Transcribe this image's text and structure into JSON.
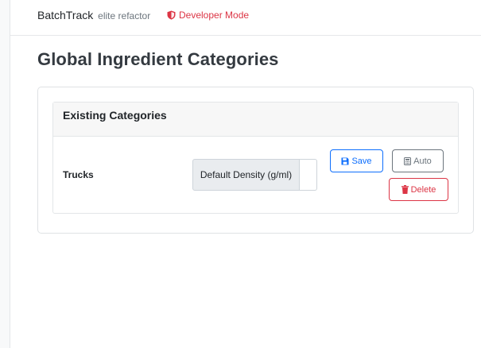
{
  "header": {
    "brand": "BatchTrack",
    "brand_sub": "elite refactor",
    "dev_mode": "Developer Mode"
  },
  "page": {
    "title": "Global Ingredient Categories"
  },
  "categories_card": {
    "header": "Existing Categories",
    "rows": [
      {
        "name": "Trucks",
        "density_label": "Default Density (g/ml)",
        "density_value": "",
        "save_label": "Save",
        "auto_label": "Auto",
        "delete_label": "Delete"
      }
    ]
  },
  "colors": {
    "primary": "#0d6efd",
    "secondary": "#6c757d",
    "danger": "#dc3545"
  },
  "icons": {
    "dev_mode": "shield-icon",
    "save": "floppy-disk-icon",
    "auto": "calculator-icon",
    "delete": "trash-icon"
  }
}
